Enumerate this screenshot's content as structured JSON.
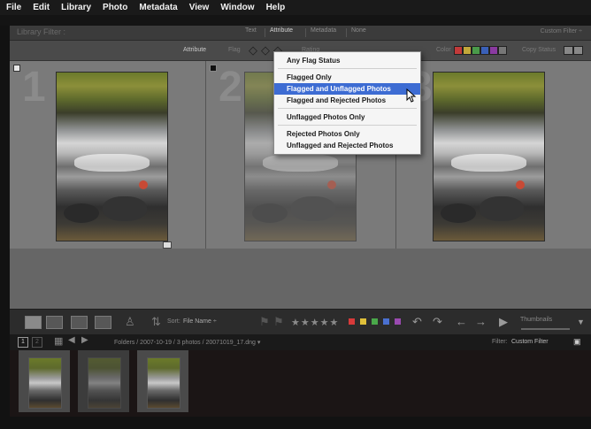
{
  "menu": [
    "File",
    "Edit",
    "Library",
    "Photo",
    "Metadata",
    "View",
    "Window",
    "Help"
  ],
  "filterbar": {
    "title": "Library Filter :",
    "tabs": [
      "Text",
      "Attribute",
      "Metadata",
      "None"
    ],
    "active_tab": "Attribute",
    "custom_filter": "Custom Filter ÷"
  },
  "attrbar": {
    "attribute_label": "Attribute",
    "flag_label": "Flag",
    "rating_label": "Rating",
    "color_label": "Color",
    "copy_status_label": "Copy Status"
  },
  "dropdown": {
    "items": [
      "Any Flag Status",
      "Flagged Only",
      "Flagged and Unflagged Photos",
      "Flagged and Rejected Photos",
      "Unflagged Photos Only",
      "Rejected Photos Only",
      "Unflagged and Rejected Photos"
    ],
    "selected": "Flagged and Unflagged Photos"
  },
  "grid": {
    "cell_numbers": [
      "1",
      "2",
      "3"
    ]
  },
  "toolbar": {
    "sort_label": "Sort:",
    "sort_value": "File Name ÷",
    "thumbnails_label": "Thumbnails",
    "stars": "★★★★★",
    "label_colors": [
      "#d83a3a",
      "#e0c03a",
      "#4aa84a",
      "#4a70d0",
      "#9a4ab0"
    ]
  },
  "filmstrip": {
    "pages": [
      "1",
      "2"
    ],
    "path": "Folders / 2007-10-19 / 3 photos / 20071019_17.dng ▾",
    "filter_label": "Filter:",
    "filter_value": "Custom Filter"
  },
  "colors": {
    "accent": "#3d6cd3",
    "panel": "#4a4a4a",
    "grid_bg": "#666666"
  }
}
